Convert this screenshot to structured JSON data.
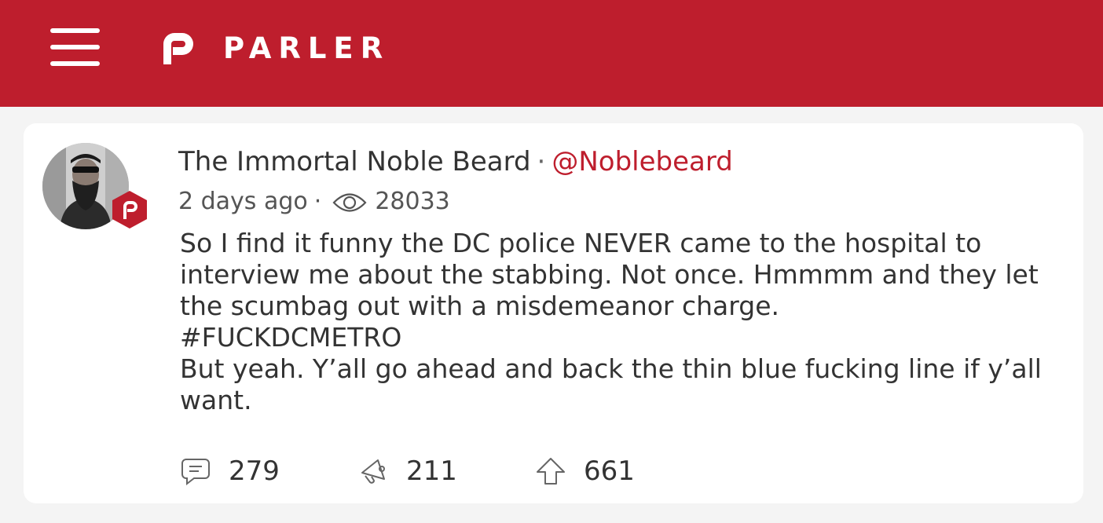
{
  "header": {
    "brand": "PARLER",
    "menu_icon": "hamburger-menu-icon",
    "logo_icon": "parler-p-logo-icon",
    "background_color": "#be1e2d"
  },
  "post": {
    "author_name": "The Immortal Noble Beard",
    "separator": "·",
    "handle": "@Noblebeard",
    "time_ago": "2 days ago",
    "views_icon": "eye-icon",
    "views": "28033",
    "text": "So I find it funny the DC police NEVER came to the hospital to interview me about the stabbing. Not once. Hmmmm and they let the scumbag out with a misdemeanor charge.\n#FUCKDCMETRO\nBut yeah. Y’all go ahead and back the thin blue fucking line if y’all want.",
    "actions": {
      "comments": {
        "icon": "comment-icon",
        "count": "279"
      },
      "echoes": {
        "icon": "megaphone-icon",
        "count": "211"
      },
      "upvotes": {
        "icon": "upvote-arrow-icon",
        "count": "661"
      }
    },
    "accent_color": "#be1e2d"
  }
}
